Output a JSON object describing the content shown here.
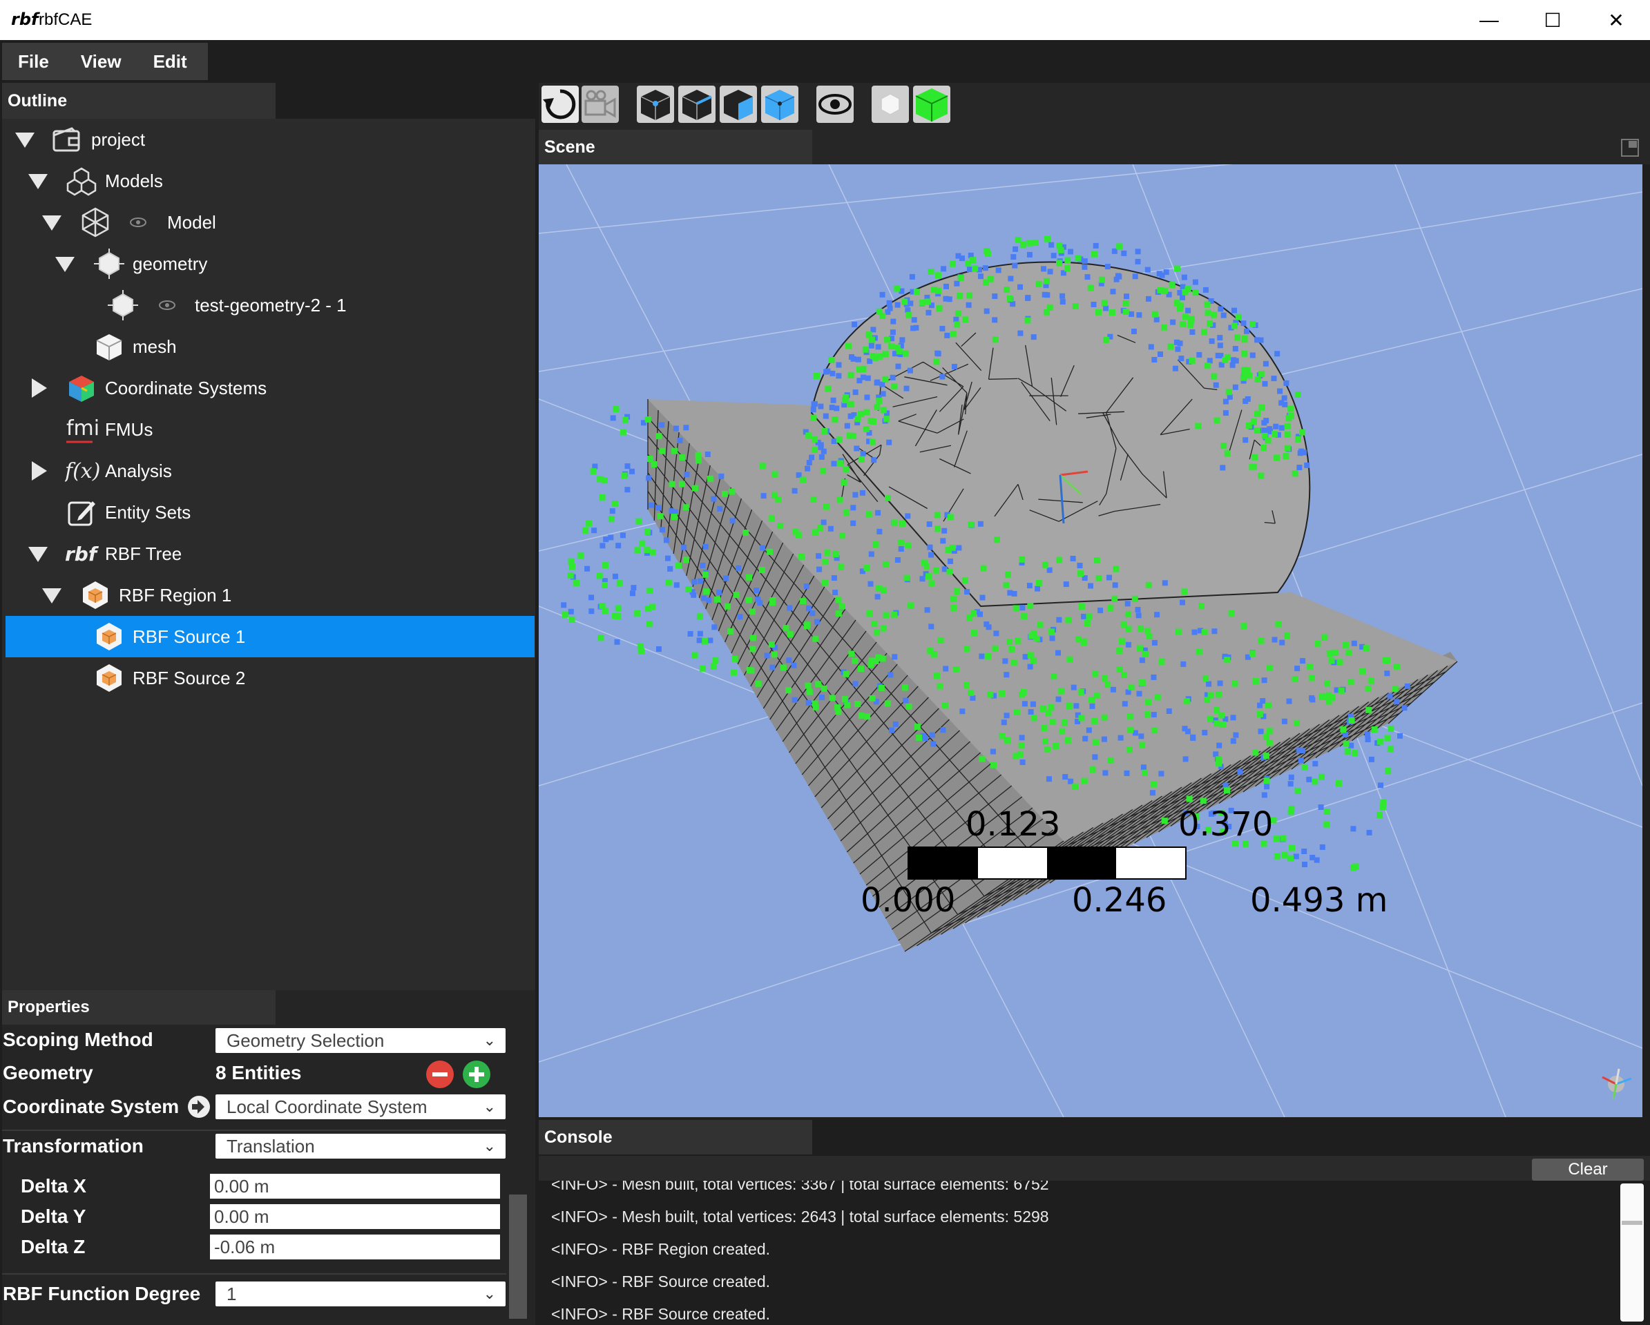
{
  "window": {
    "logo": "rbf",
    "title": "rbfCAE",
    "minimize": "—",
    "maximize": "☐",
    "close": "✕"
  },
  "menu": [
    "File",
    "View",
    "Edit"
  ],
  "outline": {
    "header": "Outline",
    "items": [
      {
        "label": "project"
      },
      {
        "label": "Models"
      },
      {
        "label": "Model"
      },
      {
        "label": "geometry"
      },
      {
        "label": "test-geometry-2 - 1"
      },
      {
        "label": "mesh"
      },
      {
        "label": "Coordinate Systems"
      },
      {
        "label": "FMUs"
      },
      {
        "label": "Analysis"
      },
      {
        "label": "Entity Sets"
      },
      {
        "label": "RBF Tree"
      },
      {
        "label": "RBF Region 1"
      },
      {
        "label": "RBF Source 1"
      },
      {
        "label": "RBF Source 2"
      }
    ]
  },
  "scene": {
    "header": "Scene",
    "scale_bar": {
      "top_labels": [
        "0.123",
        "0.370"
      ],
      "bottom_labels": [
        "0.000",
        "0.246",
        "0.493 m"
      ]
    }
  },
  "properties": {
    "header": "Properties",
    "scoping_method": {
      "label": "Scoping Method",
      "value": "Geometry Selection"
    },
    "geometry": {
      "label": "Geometry",
      "value": "8 Entities"
    },
    "coordinate_system": {
      "label": "Coordinate System",
      "value": "Local Coordinate System"
    },
    "transformation": {
      "label": "Transformation",
      "value": "Translation"
    },
    "delta_x": {
      "label": "Delta X",
      "value": "0.00 m"
    },
    "delta_y": {
      "label": "Delta Y",
      "value": "0.00 m"
    },
    "delta_z": {
      "label": "Delta Z",
      "value": "-0.06 m"
    },
    "rbf_degree": {
      "label": "RBF Function Degree",
      "value": "1"
    }
  },
  "console": {
    "header": "Console",
    "clear_label": "Clear",
    "lines": [
      "<INFO> - Mesh built, total vertices: 3367 | total surface elements: 6752",
      "<INFO> - Mesh built, total vertices: 2643 | total surface elements: 5298",
      "<INFO> - RBF Region created.",
      "<INFO> - RBF Source created.",
      "<INFO> - RBF Source created."
    ]
  }
}
